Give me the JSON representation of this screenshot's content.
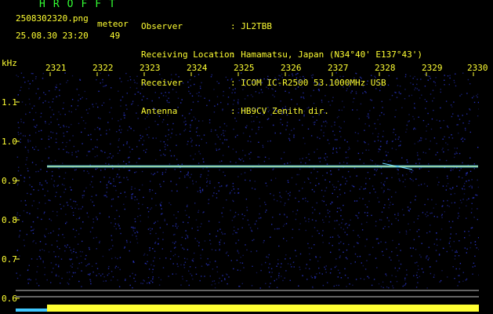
{
  "header": {
    "brand": "HROFFT",
    "filename": "2508302320.png",
    "datetime": "25.08.30 23:20",
    "meteor_label": "meteor",
    "meteor_count": "49"
  },
  "meta": [
    {
      "key": "Observer",
      "value": ": JL2TBB"
    },
    {
      "key": "Receiving Location",
      "value": ": Hamamatsu, Japan (N34°40' E137°43')"
    },
    {
      "key": "Receiver",
      "value": ": ICOM IC-R2500 53.1000MHz USB"
    },
    {
      "key": "Antenna",
      "value": ": HB9CV Zenith dir."
    }
  ],
  "axes": {
    "y_unit": "kHz",
    "x_ticks": [
      "2321",
      "2322",
      "2323",
      "2324",
      "2325",
      "2326",
      "2327",
      "2328",
      "2329",
      "2330"
    ],
    "y_ticks": [
      "1.1",
      "1.0",
      "0.9",
      "0.8",
      "0.7",
      "0.6"
    ]
  },
  "colors": {
    "background": "#000000",
    "text": "#ffff33",
    "brand": "#33ff33",
    "noise": "#2a35c8",
    "signal_core": "#f0ff80",
    "signal_edge": "#40c8ff",
    "bottom_bar": "#ffff33"
  },
  "signal": {
    "start_time": "2321",
    "end_time": "2330",
    "frequency_khz": 0.935
  }
}
